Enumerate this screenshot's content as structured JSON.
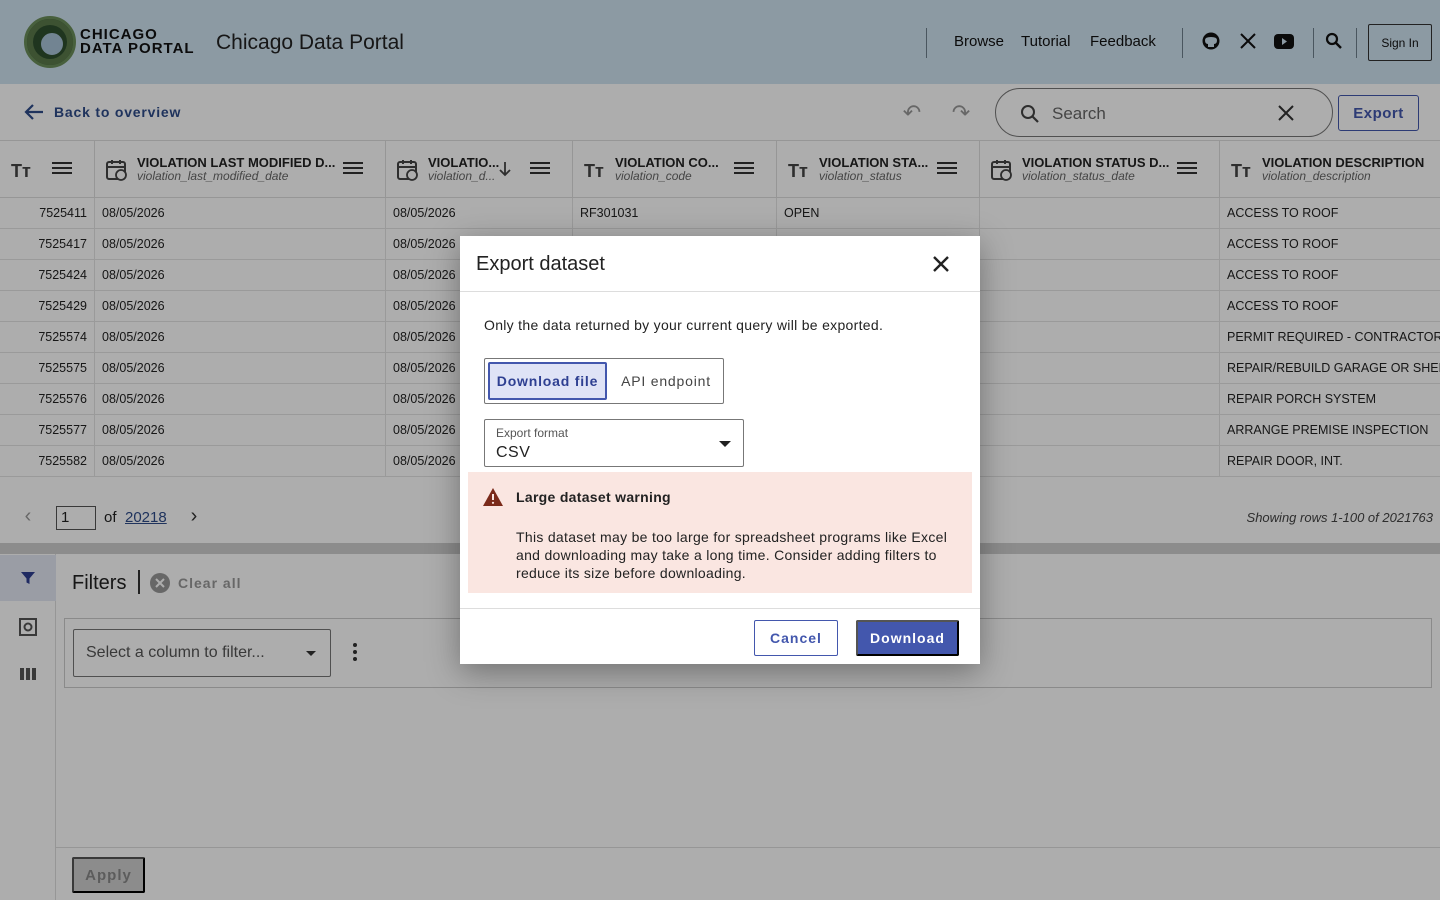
{
  "header": {
    "logo_line1": "CHICAGO",
    "logo_line2": "DATA PORTAL",
    "site_title": "Chicago Data Portal",
    "nav": [
      "Browse",
      "Tutorial",
      "Feedback"
    ],
    "sign_in_label": "Sign In",
    "icons": [
      "github-icon",
      "x-icon",
      "youtube-icon",
      "search-icon"
    ]
  },
  "toolbar": {
    "back_label": "Back to overview",
    "search_placeholder": "Search",
    "export_label": "Export"
  },
  "grid": {
    "columns": [
      {
        "name": "",
        "field": "",
        "type": "text"
      },
      {
        "name": "VIOLATION LAST MODIFIED D...",
        "field": "violation_last_modified_date",
        "type": "date"
      },
      {
        "name": "VIOLATIO...",
        "field": "violation_d...",
        "type": "date",
        "sorted": "desc"
      },
      {
        "name": "VIOLATION CO...",
        "field": "violation_code",
        "type": "text"
      },
      {
        "name": "VIOLATION STA...",
        "field": "violation_status",
        "type": "text"
      },
      {
        "name": "VIOLATION STATUS D...",
        "field": "violation_status_date",
        "type": "date"
      },
      {
        "name": "VIOLATION DESCRIPTION",
        "field": "violation_description",
        "type": "text"
      }
    ],
    "rows": [
      [
        "7525411",
        "08/05/2026",
        "08/05/2026",
        "RF301031",
        "OPEN",
        "",
        "ACCESS TO ROOF"
      ],
      [
        "7525417",
        "08/05/2026",
        "08/05/2026",
        "",
        "",
        "",
        "ACCESS TO ROOF"
      ],
      [
        "7525424",
        "08/05/2026",
        "08/05/2026",
        "",
        "",
        "",
        "ACCESS TO ROOF"
      ],
      [
        "7525429",
        "08/05/2026",
        "08/05/2026",
        "",
        "",
        "",
        "ACCESS TO ROOF"
      ],
      [
        "7525574",
        "08/05/2026",
        "08/05/2026",
        "",
        "",
        "",
        "PERMIT REQUIRED - CONTRACTOR"
      ],
      [
        "7525575",
        "08/05/2026",
        "08/05/2026",
        "",
        "",
        "",
        "REPAIR/REBUILD GARAGE OR SHED"
      ],
      [
        "7525576",
        "08/05/2026",
        "08/05/2026",
        "",
        "",
        "",
        "REPAIR PORCH SYSTEM"
      ],
      [
        "7525577",
        "08/05/2026",
        "08/05/2026",
        "",
        "",
        "",
        "ARRANGE PREMISE INSPECTION"
      ],
      [
        "7525582",
        "08/05/2026",
        "08/05/2026",
        "",
        "",
        "",
        "REPAIR DOOR, INT."
      ]
    ]
  },
  "pager": {
    "current_page": "1",
    "of_label": "of",
    "total_pages": "20218",
    "showing": "Showing rows 1-100 of 2021763"
  },
  "filters": {
    "title": "Filters",
    "clear_all": "Clear all",
    "select_placeholder": "Select a column to filter...",
    "apply_label": "Apply"
  },
  "modal": {
    "title": "Export dataset",
    "note": "Only the data returned by your current query will be exported.",
    "tab_download": "Download file",
    "tab_api": "API endpoint",
    "format_label": "Export format",
    "format_value": "CSV",
    "warning_title": "Large dataset warning",
    "warning_body": "This dataset may be too large for spreadsheet programs like Excel and downloading may take a long time. Consider adding filters to reduce its size before downloading.",
    "cancel_label": "Cancel",
    "download_label": "Download"
  },
  "colors": {
    "header_bg": "#cfe3f1",
    "primary": "#4357ad",
    "warning_bg": "#fae6e1",
    "warning_icon": "#7a2a1a"
  }
}
